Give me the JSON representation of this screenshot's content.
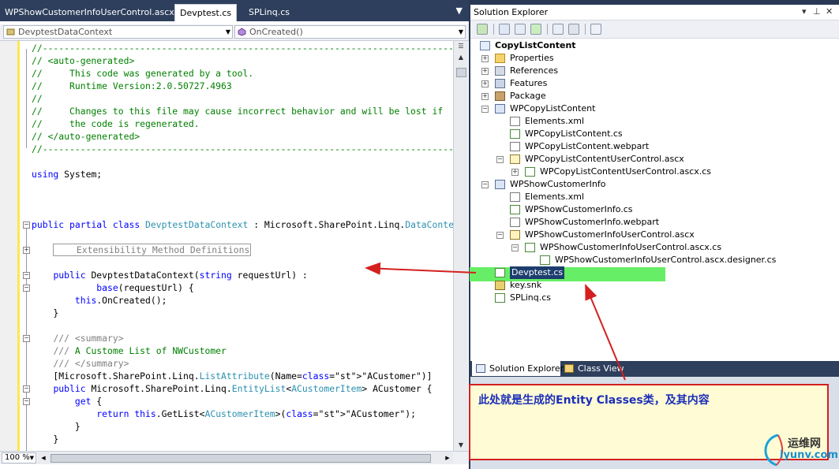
{
  "editor": {
    "tabs": [
      "WPShowCustomerInfoUserControl.ascx",
      "Devptest.cs",
      "SPLinq.cs"
    ],
    "active_tab": "Devptest.cs",
    "tab_menu_icon": "dropdown-arrow-icon",
    "class_combo": "DevptestDataContext",
    "member_combo": "OnCreated()",
    "zoom": "100 %",
    "code_lines": [
      "//------------------------------------------------------------------------------",
      "// <auto-generated>",
      "//     This code was generated by a tool.",
      "//     Runtime Version:2.0.50727.4963",
      "//",
      "//     Changes to this file may cause incorrect behavior and will be lost if",
      "//     the code is regenerated.",
      "// </auto-generated>",
      "//------------------------------------------------------------------------------",
      "",
      "using System;",
      "",
      "",
      "",
      "public partial class DevptestDataContext : Microsoft.SharePoint.Linq.DataContext {",
      "",
      "    Extensibility Method Definitions",
      "",
      "    public DevptestDataContext(string requestUrl) :",
      "            base(requestUrl) {",
      "        this.OnCreated();",
      "    }",
      "",
      "    /// <summary>",
      "    /// A Custome List of NWCustomer",
      "    /// </summary>",
      "    [Microsoft.SharePoint.Linq.ListAttribute(Name=\"ACustomer\")]",
      "    public Microsoft.SharePoint.Linq.EntityList<ACustomerItem> ACustomer {",
      "        get {",
      "            return this.GetList<ACustomerItem>(\"ACustomer\");",
      "        }",
      "    }"
    ]
  },
  "solution_explorer": {
    "title": "Solution Explorer",
    "title_controls": [
      "▾",
      "📌",
      "✕"
    ],
    "tree": [
      {
        "label": "CopyListContent",
        "depth": 0,
        "icon": "project",
        "bold": true,
        "expander": ""
      },
      {
        "label": "Properties",
        "depth": 1,
        "icon": "folder",
        "expander": "+"
      },
      {
        "label": "References",
        "depth": 1,
        "icon": "references",
        "expander": "+"
      },
      {
        "label": "Features",
        "depth": 1,
        "icon": "features",
        "expander": "+"
      },
      {
        "label": "Package",
        "depth": 1,
        "icon": "package",
        "expander": "+"
      },
      {
        "label": "WPCopyListContent",
        "depth": 1,
        "icon": "webpart-item",
        "expander": "−"
      },
      {
        "label": "Elements.xml",
        "depth": 2,
        "icon": "xml",
        "expander": ""
      },
      {
        "label": "WPCopyListContent.cs",
        "depth": 2,
        "icon": "cs",
        "expander": ""
      },
      {
        "label": "WPCopyListContent.webpart",
        "depth": 2,
        "icon": "xml",
        "expander": ""
      },
      {
        "label": "WPCopyListContentUserControl.ascx",
        "depth": 2,
        "icon": "ascx",
        "expander": "−"
      },
      {
        "label": "WPCopyListContentUserControl.ascx.cs",
        "depth": 3,
        "icon": "cs",
        "expander": "+"
      },
      {
        "label": "WPShowCustomerInfo",
        "depth": 1,
        "icon": "webpart-item",
        "expander": "−"
      },
      {
        "label": "Elements.xml",
        "depth": 2,
        "icon": "xml",
        "expander": ""
      },
      {
        "label": "WPShowCustomerInfo.cs",
        "depth": 2,
        "icon": "cs",
        "expander": ""
      },
      {
        "label": "WPShowCustomerInfo.webpart",
        "depth": 2,
        "icon": "xml",
        "expander": ""
      },
      {
        "label": "WPShowCustomerInfoUserControl.ascx",
        "depth": 2,
        "icon": "ascx",
        "expander": "−"
      },
      {
        "label": "WPShowCustomerInfoUserControl.ascx.cs",
        "depth": 3,
        "icon": "cs",
        "expander": "−"
      },
      {
        "label": "WPShowCustomerInfoUserControl.ascx.designer.cs",
        "depth": 4,
        "icon": "cs",
        "expander": ""
      },
      {
        "label": "Devptest.cs",
        "depth": 1,
        "icon": "cs",
        "expander": "",
        "selected": true
      },
      {
        "label": "key.snk",
        "depth": 1,
        "icon": "key",
        "expander": ""
      },
      {
        "label": "SPLinq.cs",
        "depth": 1,
        "icon": "cs",
        "expander": ""
      }
    ],
    "bottom_tabs": [
      "Solution Explorer",
      "Class View"
    ],
    "highlight_color": "#66ee66"
  },
  "annotation": {
    "text": "此处就是生成的Entity Classes类，及其内容",
    "border_color": "#d42020",
    "text_color": "#1c2fb8"
  },
  "watermark": {
    "line1": "运维网",
    "line2": "iyunv.com"
  },
  "colors": {
    "keyword": "#0000ff",
    "comment": "#008000",
    "type": "#2b91af",
    "string": "#a31515",
    "chrome": "#2d3f5c"
  }
}
